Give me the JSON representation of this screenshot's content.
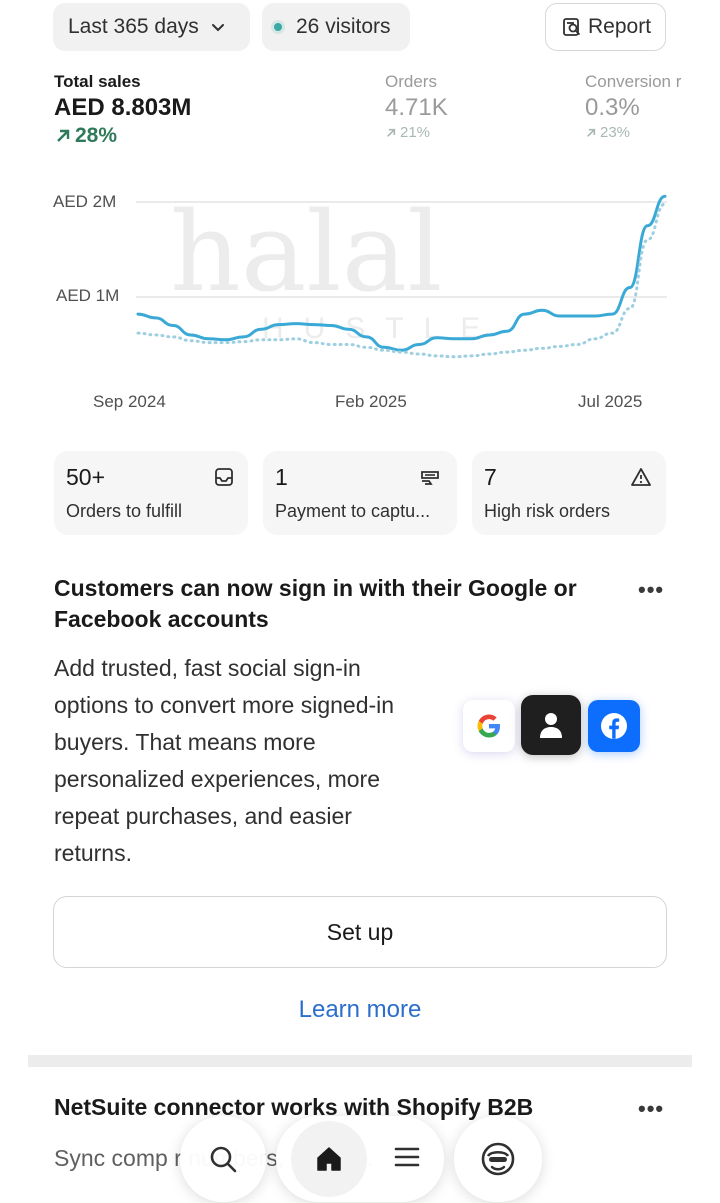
{
  "filters": {
    "date_range": "Last 365 days",
    "visitors": "26 visitors",
    "report_label": "Report"
  },
  "metrics": {
    "total_sales": {
      "label": "Total sales",
      "value": "AED 8.803M",
      "delta": "28%"
    },
    "orders": {
      "label": "Orders",
      "value": "4.71K",
      "delta": "21%"
    },
    "conversion": {
      "label": "Conversion r",
      "value": "0.3%",
      "delta": "23%"
    }
  },
  "chart_data": {
    "type": "line",
    "title": "",
    "x_ticks": [
      "Sep 2024",
      "Feb 2025",
      "Jul 2025"
    ],
    "y_ticks": [
      "AED 2M",
      "AED 1M"
    ],
    "ylim": [
      0,
      2.2
    ],
    "grid": true,
    "series": [
      {
        "style": "solid",
        "color": "#3aa9d6",
        "values": [
          0.82,
          0.78,
          0.7,
          0.6,
          0.56,
          0.55,
          0.58,
          0.66,
          0.71,
          0.72,
          0.71,
          0.7,
          0.66,
          0.58,
          0.47,
          0.44,
          0.5,
          0.57,
          0.56,
          0.56,
          0.6,
          0.64,
          0.82,
          0.86,
          0.8,
          0.8,
          0.8,
          0.82,
          1.1,
          1.75,
          2.06
        ]
      },
      {
        "style": "dotted",
        "color": "#9ecfe0",
        "values": [
          0.62,
          0.6,
          0.58,
          0.54,
          0.52,
          0.52,
          0.53,
          0.55,
          0.55,
          0.56,
          0.52,
          0.5,
          0.5,
          0.47,
          0.44,
          0.42,
          0.4,
          0.38,
          0.37,
          0.38,
          0.4,
          0.42,
          0.44,
          0.46,
          0.48,
          0.5,
          0.56,
          0.62,
          0.88,
          1.6,
          1.98
        ]
      }
    ]
  },
  "quick_actions": [
    {
      "count": "50+",
      "label": "Orders to fulfill",
      "icon": "inbox-icon"
    },
    {
      "count": "1",
      "label": "Payment to captu...",
      "icon": "cash-icon"
    },
    {
      "count": "7",
      "label": "High risk orders",
      "icon": "alert-triangle-icon"
    }
  ],
  "promo": {
    "title": "Customers can now sign in with their Google or Facebook accounts",
    "body": "Add trusted, fast social sign-in options to convert more signed-in buyers. That means more personalized experiences, more repeat purchases, and easier returns.",
    "setup_label": "Set up",
    "learn_more_label": "Learn more",
    "more_label": "•••"
  },
  "card2": {
    "title": "NetSuite connector works with Shopify B2B",
    "body": "Sync comp   r numbers, pa   nt te.",
    "more_label": "•••"
  },
  "watermark": {
    "text_top": "halal",
    "text_bottom": "HUSTLE"
  },
  "colors": {
    "accent_green": "#2e7a5a",
    "link_blue": "#2c6ecb",
    "chart_line": "#3aa9d6",
    "facebook_blue": "#0d6efd"
  }
}
